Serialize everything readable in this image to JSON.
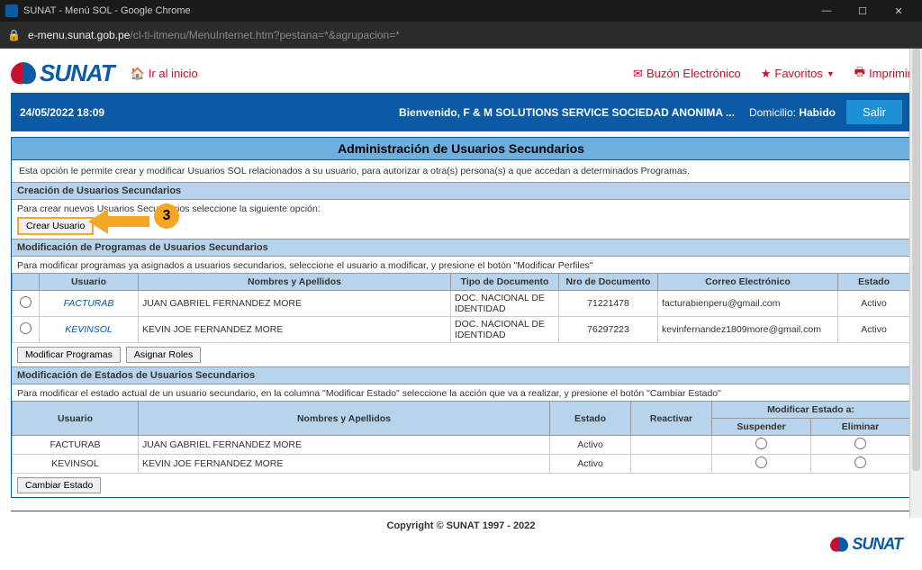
{
  "window": {
    "title": "SUNAT - Menú SOL - Google Chrome",
    "url_domain": "e-menu.sunat.gob.pe",
    "url_path": "/cl-ti-itmenu/MenuInternet.htm?pestana=*&agrupacion=*"
  },
  "brand": "SUNAT",
  "nav": {
    "home": "Ir al inicio",
    "buzon": "Buzón Electrónico",
    "favoritos": "Favoritos",
    "imprimir": "Imprimir"
  },
  "bluebar": {
    "datetime": "24/05/2022 18:09",
    "welcome": "Bienvenido, F & M SOLUTIONS SERVICE SOCIEDAD ANONIMA ...",
    "domicilio_label": "Domicilio:",
    "domicilio_value": "Habido",
    "salir": "Salir"
  },
  "page": {
    "title": "Administración de Usuarios Secundarios",
    "intro": "Esta opción le permite crear y modificar Usuarios SOL relacionados a su usuario, para autorizar a otra(s) persona(s) a que accedan a determinados Programas."
  },
  "create": {
    "header": "Creación de Usuarios Secundarios",
    "hint": "Para crear nuevos Usuarios Secundarios seleccione la siguiente opción:",
    "button": "Crear Usuario"
  },
  "mod_prog": {
    "header": "Modificación de Programas de Usuarios Secundarios",
    "hint": "Para modificar programas ya asignados a usuarios secundarios, seleccione el usuario a modificar, y presione el botón \"Modificar Perfiles\"",
    "cols": {
      "usuario": "Usuario",
      "nombres": "Nombres y Apellidos",
      "tipo_doc": "Tipo de Documento",
      "nro_doc": "Nro de Documento",
      "correo": "Correo Electrónico",
      "estado": "Estado"
    },
    "rows": [
      {
        "usuario": "FACTURAB",
        "nombres": "JUAN GABRIEL  FERNANDEZ MORE",
        "tipo_doc": "DOC. NACIONAL DE IDENTIDAD",
        "nro_doc": "71221478",
        "correo": "facturabienperu@gmail.com",
        "estado": "Activo"
      },
      {
        "usuario": "KEVINSOL",
        "nombres": "KEVIN JOE  FERNANDEZ MORE",
        "tipo_doc": "DOC. NACIONAL DE IDENTIDAD",
        "nro_doc": "76297223",
        "correo": "kevinfernandez1809more@gmail.com",
        "estado": "Activo"
      }
    ],
    "btn_mod": "Modificar Programas",
    "btn_roles": "Asignar Roles"
  },
  "mod_estado": {
    "header": "Modificación de Estados de Usuarios Secundarios",
    "hint": "Para modificar el estado actual de un usuario secundario, en la columna \"Modificar Estado\" seleccione la acción que va a realizar, y presione el botón \"Cambiar Estado\"",
    "sup_header": "Modificar Estado a:",
    "cols": {
      "usuario": "Usuario",
      "nombres": "Nombres y Apellidos",
      "estado": "Estado",
      "reactivar": "Reactivar",
      "suspender": "Suspender",
      "eliminar": "Eliminar"
    },
    "rows": [
      {
        "usuario": "FACTURAB",
        "nombres": "JUAN GABRIEL  FERNANDEZ MORE",
        "estado": "Activo"
      },
      {
        "usuario": "KEVINSOL",
        "nombres": "KEVIN JOE  FERNANDEZ MORE",
        "estado": "Activo"
      }
    ],
    "btn_cambiar": "Cambiar Estado"
  },
  "footer": {
    "copyright": "Copyright © SUNAT 1997 - 2022"
  },
  "annotation": {
    "step": "3"
  }
}
